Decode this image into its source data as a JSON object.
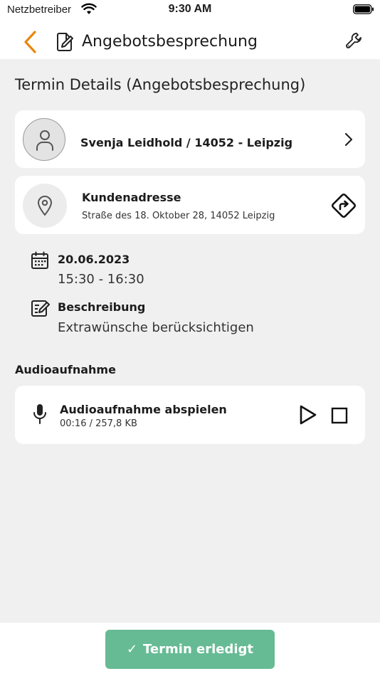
{
  "status_bar": {
    "carrier": "Netzbetreiber",
    "time": "9:30 AM"
  },
  "nav": {
    "title": "Angebotsbesprechung",
    "accent_color": "#e8870e"
  },
  "section_title": "Termin Details (Angebotsbesprechung)",
  "customer": {
    "name": "Svenja Leidhold / 14052 - Leipzig"
  },
  "address": {
    "label": "Kundenadresse",
    "value": "Straße des 18. Oktober 28, 14052 Leipzig"
  },
  "appointment": {
    "date": "20.06.2023",
    "time_range": "15:30 - 16:30"
  },
  "description": {
    "label": "Beschreibung",
    "text": "Extrawünsche berücksichtigen"
  },
  "audio": {
    "heading": "Audioaufnahme",
    "title": "Audioaufnahme abspielen",
    "meta": "00:16 / 257,8 KB"
  },
  "footer": {
    "done_label": "Termin erledigt",
    "done_color": "#66bb94"
  },
  "icons": [
    "wifi-icon",
    "battery-icon",
    "back-chevron-icon",
    "edit-document-icon",
    "wrench-icon",
    "person-icon",
    "chevron-right-icon",
    "location-pin-icon",
    "directions-icon",
    "calendar-icon",
    "edit-note-icon",
    "microphone-icon",
    "play-icon",
    "stop-icon",
    "checkmark-icon"
  ]
}
